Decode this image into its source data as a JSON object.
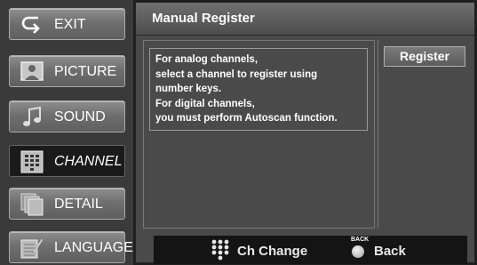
{
  "sidebar": {
    "items": [
      {
        "label": "EXIT",
        "icon": "exit-icon"
      },
      {
        "label": "PICTURE",
        "icon": "picture-icon"
      },
      {
        "label": "SOUND",
        "icon": "music-note-icon"
      },
      {
        "label": "CHANNEL",
        "icon": "channel-grid-icon",
        "active": true
      },
      {
        "label": "DETAIL",
        "icon": "detail-pages-icon"
      },
      {
        "label": "LANGUAGE",
        "icon": "language-icon"
      }
    ]
  },
  "header": {
    "title": "Manual Register"
  },
  "message": {
    "lines": [
      "For analog channels,",
      "select a channel to register using",
      "number keys.",
      "For digital channels,",
      "you must perform Autoscan function."
    ]
  },
  "side_panel": {
    "register_label": "Register"
  },
  "footer": {
    "ch_change_label": "Ch Change",
    "back_tag": "BACK",
    "back_label": "Back"
  },
  "colors": {
    "background": "#1f1f1f",
    "panel": "#4a4a4a",
    "active_menu": "#1a1a1a"
  }
}
